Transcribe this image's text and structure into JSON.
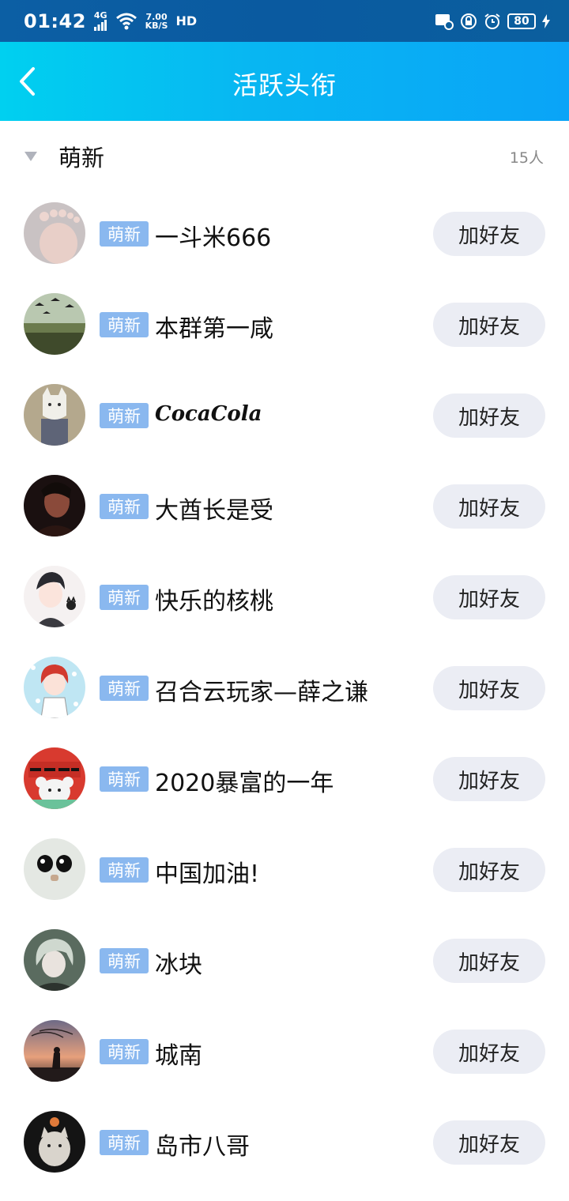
{
  "status_bar": {
    "time": "01:42",
    "network": "4G",
    "speed_value": "7.00",
    "speed_unit": "KB/S",
    "hd": "HD",
    "battery": "80"
  },
  "header": {
    "title": "活跃头衔"
  },
  "group": {
    "title": "萌新",
    "count": "15人"
  },
  "badge_label": "萌新",
  "add_friend_label": "加好友",
  "members": [
    {
      "name": "一斗米666",
      "avatar": "feet-photo-avatar"
    },
    {
      "name": "本群第一咸",
      "avatar": "graduation-photo-avatar"
    },
    {
      "name": "CocaCola",
      "avatar": "cat-mask-avatar"
    },
    {
      "name": "大酋长是受",
      "avatar": "dark-portrait-avatar"
    },
    {
      "name": "快乐的核桃",
      "avatar": "anime-boy-avatar"
    },
    {
      "name": "召合云玩家—薛之谦",
      "avatar": "anime-redhair-avatar"
    },
    {
      "name": "2020暴富的一年",
      "avatar": "new-year-mouse-avatar"
    },
    {
      "name": "中国加油!",
      "avatar": "cartoon-eyes-avatar"
    },
    {
      "name": "冰块",
      "avatar": "anime-greenhair-avatar"
    },
    {
      "name": "城南",
      "avatar": "sunset-silhouette-avatar"
    },
    {
      "name": "岛市八哥",
      "avatar": "cat-photo-avatar"
    }
  ],
  "colors": {
    "header_gradient_start": "#00d0f0",
    "header_gradient_end": "#0aa4f7",
    "badge_bg": "#8ab8ef",
    "button_bg": "#ebedf4"
  }
}
